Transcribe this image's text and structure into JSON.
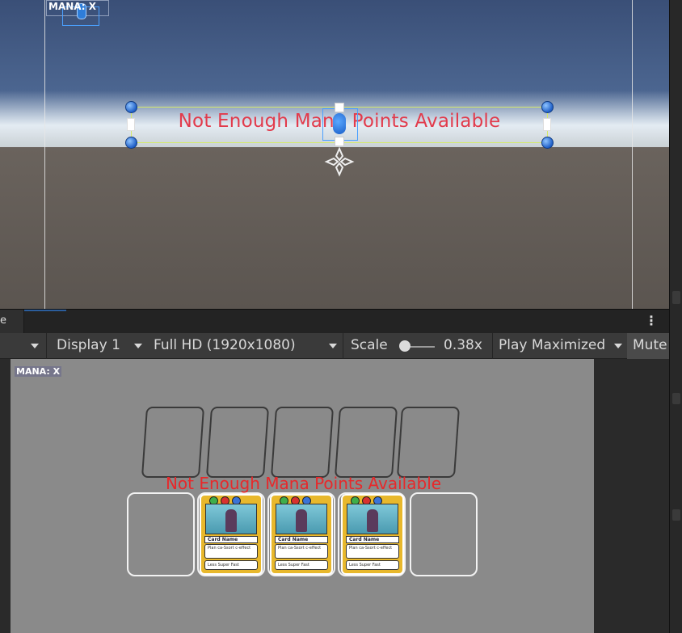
{
  "scene": {
    "mana_label": "MANA: X",
    "message": "Not Enough Mana Points Available"
  },
  "tabbar": {
    "tab_label": "e",
    "menu_dots": "⋮"
  },
  "toolbar": {
    "display": "Display 1",
    "resolution": "Full HD (1920x1080)",
    "scale_label": "Scale",
    "scale_value": "0.38x",
    "play_mode": "Play Maximized",
    "mute": "Mute"
  },
  "game": {
    "mana_label": "MANA: X",
    "message": "Not Enough Mana Points Available",
    "cards": [
      {
        "name": "Card Name",
        "description": "Plan ca-Ssort c-effect",
        "footer": "Less Super Fast"
      },
      {
        "name": "Card Name",
        "description": "Plan ca-Ssort c-effect",
        "footer": "Less Super Fast"
      },
      {
        "name": "Card Name",
        "description": "Plan ca-Ssort c-effect",
        "footer": "Less Super Fast"
      }
    ]
  },
  "colors": {
    "message_red": "#e23b4c",
    "selection_blue": "#4aa0ff",
    "card_gold": "#e8b82c"
  }
}
